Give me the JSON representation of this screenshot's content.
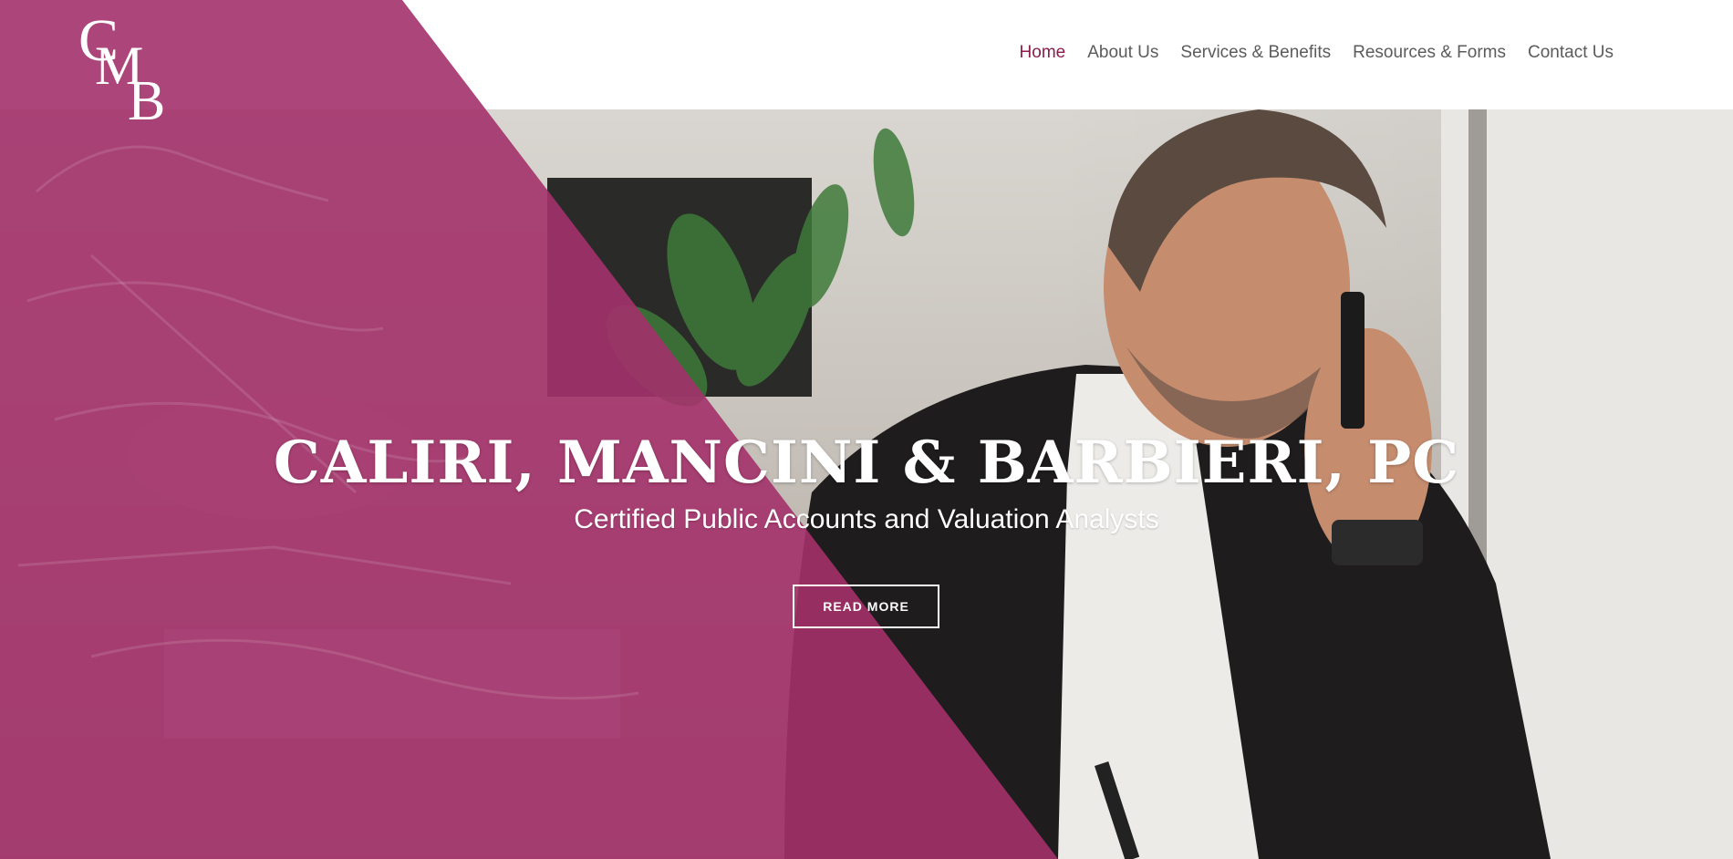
{
  "logo": {
    "letters": [
      "C",
      "M",
      "B"
    ]
  },
  "nav": {
    "items": [
      {
        "label": "Home",
        "active": true
      },
      {
        "label": "About Us"
      },
      {
        "label": "Services & Benefits"
      },
      {
        "label": "Resources & Forms"
      },
      {
        "label": "Contact Us"
      }
    ]
  },
  "hero": {
    "title": "CALIRI, MANCINI & BARBIERI, PC",
    "subtitle": "Certified Public Accounts and Valuation Analysts",
    "cta_label": "READ MORE"
  },
  "colors": {
    "accent": "#8c1d4b",
    "overlay": "#a3316a",
    "nav_text": "#5b5b5b"
  }
}
